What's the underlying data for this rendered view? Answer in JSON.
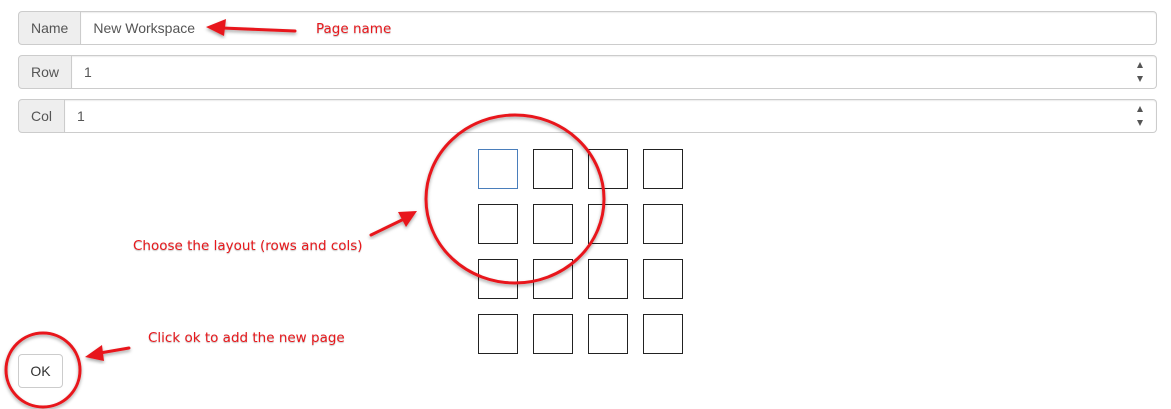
{
  "form": {
    "name": {
      "label": "Name",
      "value": "New Workspace"
    },
    "row": {
      "label": "Row",
      "value": "1"
    },
    "col": {
      "label": "Col",
      "value": "1"
    }
  },
  "layout_grid": {
    "rows": 4,
    "cols": 4,
    "selected_rows": 1,
    "selected_cols": 1
  },
  "ok_button": {
    "label": "OK"
  },
  "annotations": {
    "page_name": "Page name",
    "choose_layout": "Choose the layout (rows and cols)",
    "click_ok": "Click ok to add the new page"
  },
  "colors": {
    "annotation": "#e8181c",
    "selected_cell": "#4a7ebb",
    "cell_border": "#222222"
  }
}
